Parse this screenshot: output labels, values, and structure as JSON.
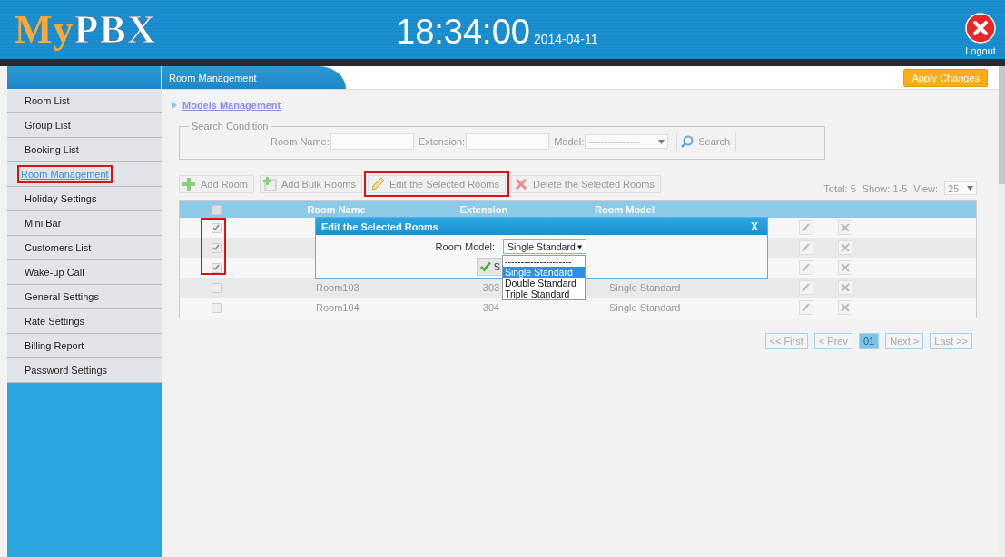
{
  "header": {
    "logo": {
      "accent": "My",
      "rest": "PBX"
    },
    "time": "18:34:00",
    "date": "2014-04-11",
    "logout": "Logout"
  },
  "sidebar": {
    "items": [
      {
        "label": "Room List",
        "selected": false,
        "highlighted": false
      },
      {
        "label": "Group List",
        "selected": false,
        "highlighted": false
      },
      {
        "label": "Booking List",
        "selected": false,
        "highlighted": false
      },
      {
        "label": "Room Management",
        "selected": true,
        "highlighted": true
      },
      {
        "label": "Holiday Settings",
        "selected": false,
        "highlighted": false
      },
      {
        "label": "Mini Bar",
        "selected": false,
        "highlighted": false
      },
      {
        "label": "Customers List",
        "selected": false,
        "highlighted": false
      },
      {
        "label": "Wake-up Call",
        "selected": false,
        "highlighted": false
      },
      {
        "label": "General Settings",
        "selected": false,
        "highlighted": false
      },
      {
        "label": "Rate Settings",
        "selected": false,
        "highlighted": false
      },
      {
        "label": "Billing Report",
        "selected": false,
        "highlighted": false
      },
      {
        "label": "Password Settings",
        "selected": false,
        "highlighted": false
      }
    ]
  },
  "page_tab": "Room Management",
  "apply_button": "Apply Changes",
  "models_link": "Models Management",
  "search": {
    "legend": "Search Condition",
    "room_name_label": "Room Name:",
    "extension_label": "Extension:",
    "model_label": "Model:",
    "model_value": "---------------------",
    "button": "Search"
  },
  "toolbar": [
    {
      "kind": "add",
      "label": "Add Room",
      "highlighted": false
    },
    {
      "kind": "bulk",
      "label": "Add Bulk Rooms",
      "highlighted": false
    },
    {
      "kind": "edit",
      "label": "Edit the Selected Rooms",
      "highlighted": true
    },
    {
      "kind": "delete",
      "label": "Delete the Selected Rooms",
      "highlighted": false
    }
  ],
  "summary": {
    "total": "Total: 5",
    "show": "Show: 1-5",
    "view_label": "View:",
    "view_value": "25"
  },
  "table": {
    "columns": [
      "Room Name",
      "Extension",
      "Room Model"
    ],
    "all_checked": false,
    "checked_highlighted": true,
    "rows": [
      {
        "checked": true
      },
      {
        "checked": true
      },
      {
        "checked": true
      },
      {
        "checked": false,
        "name": "Room103",
        "extension": "303",
        "model": "Single Standard"
      },
      {
        "checked": false,
        "name": "Room104",
        "extension": "304",
        "model": "Single Standard"
      }
    ]
  },
  "pagination": [
    {
      "label": "<< First",
      "selected": false
    },
    {
      "label": "< Prev",
      "selected": false
    },
    {
      "label": "01",
      "selected": true
    },
    {
      "label": "Next >",
      "selected": false
    },
    {
      "label": "Last >>",
      "selected": false
    }
  ],
  "dialog": {
    "title": "Edit the Selected Rooms",
    "close": "X",
    "field_label": "Room Model:",
    "field_value": "Single Standard",
    "save_button": "S",
    "options": [
      {
        "label": "---------------------",
        "selected": false
      },
      {
        "label": "Single Standard",
        "selected": true
      },
      {
        "label": "Double Standard",
        "selected": false
      },
      {
        "label": "Triple Standard",
        "selected": false
      }
    ]
  }
}
